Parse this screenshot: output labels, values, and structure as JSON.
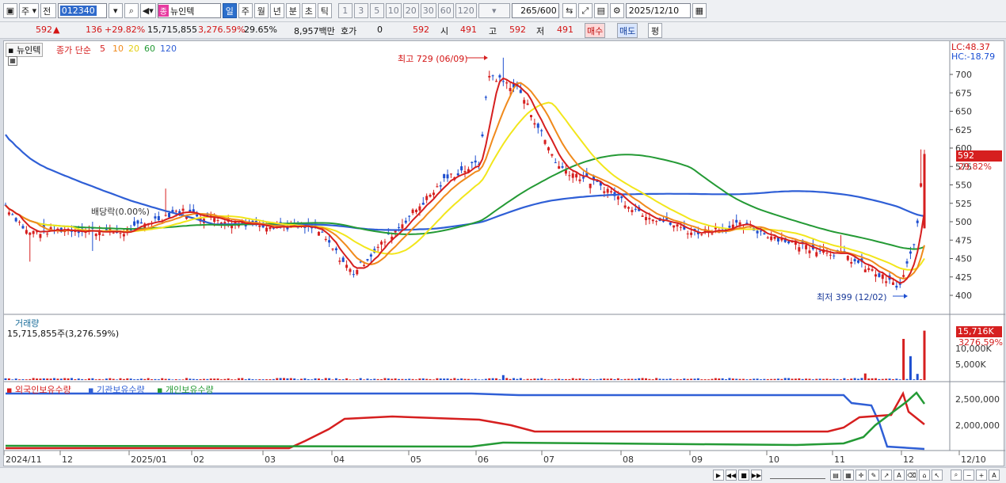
{
  "toolbar": {
    "period_type": "주",
    "market": "전",
    "code": "012340",
    "name_tag": "종",
    "stock_name": "뉴인텍",
    "periods": [
      "일",
      "주",
      "월",
      "년",
      "분",
      "초",
      "틱"
    ],
    "active_period": "일",
    "intervals": [
      "1",
      "3",
      "5",
      "10",
      "20",
      "30",
      "60",
      "120"
    ],
    "count": "265",
    "count_total": "/600",
    "date": "2025/12/10"
  },
  "quote": {
    "price": "592",
    "change": "136",
    "change_pct": "+29.82%",
    "volume": "15,715,855",
    "volume_pct": "3,276.59%",
    "turnover": "29.65%",
    "amount": "8,957백만",
    "hoga_label": "호가",
    "hoga_value": "0",
    "hoga_price": "592",
    "open_label": "시",
    "open": "491",
    "high_label": "고",
    "high": "592",
    "low_label": "저",
    "low": "491",
    "buy_label": "매수",
    "sell_label": "매도",
    "eval_label": "평"
  },
  "price_panel": {
    "name": "뉴인텍",
    "ma_title": "종가 단순",
    "ma_periods": [
      "5",
      "10",
      "20",
      "60",
      "120"
    ],
    "ma_colors": [
      "#d61f1f",
      "#f08a1c",
      "#f2e61b",
      "#249a35",
      "#2f5fd6"
    ],
    "lc": "LC:48.37",
    "hc": "HC:-18.79",
    "high_note": "최고 729 (06/09)",
    "low_note": "최저 399 (12/02)",
    "dividend_note": "배당락(0.00%)",
    "current_price": "592",
    "current_pct": "29.82%",
    "y_ticks": [
      "700",
      "675",
      "650",
      "625",
      "600",
      "575",
      "550",
      "525",
      "500",
      "475",
      "450",
      "425",
      "400"
    ]
  },
  "volume_panel": {
    "title": "거래량",
    "summary": "15,715,855주(3,276.59%)",
    "current": "15,716K",
    "current_pct": "3276.59%",
    "y_ticks": [
      "10,000K",
      "5,000K"
    ]
  },
  "holdings_panel": {
    "legend": [
      "외국인보유수량",
      "기관보유수량",
      "개인보유수량"
    ],
    "legend_colors": [
      "#d61f1f",
      "#2f5fd6",
      "#249a35"
    ],
    "y_ticks": [
      "2,500,000",
      "2,000,000"
    ]
  },
  "x_axis": [
    "2024/11",
    "12",
    "2025/01",
    "02",
    "03",
    "04",
    "05",
    "06",
    "07",
    "08",
    "09",
    "10",
    "11",
    "12",
    "12/10"
  ],
  "colors": {
    "up": "#d61f1f",
    "down": "#1e4fd0",
    "accent": "#2c6fcc"
  }
}
